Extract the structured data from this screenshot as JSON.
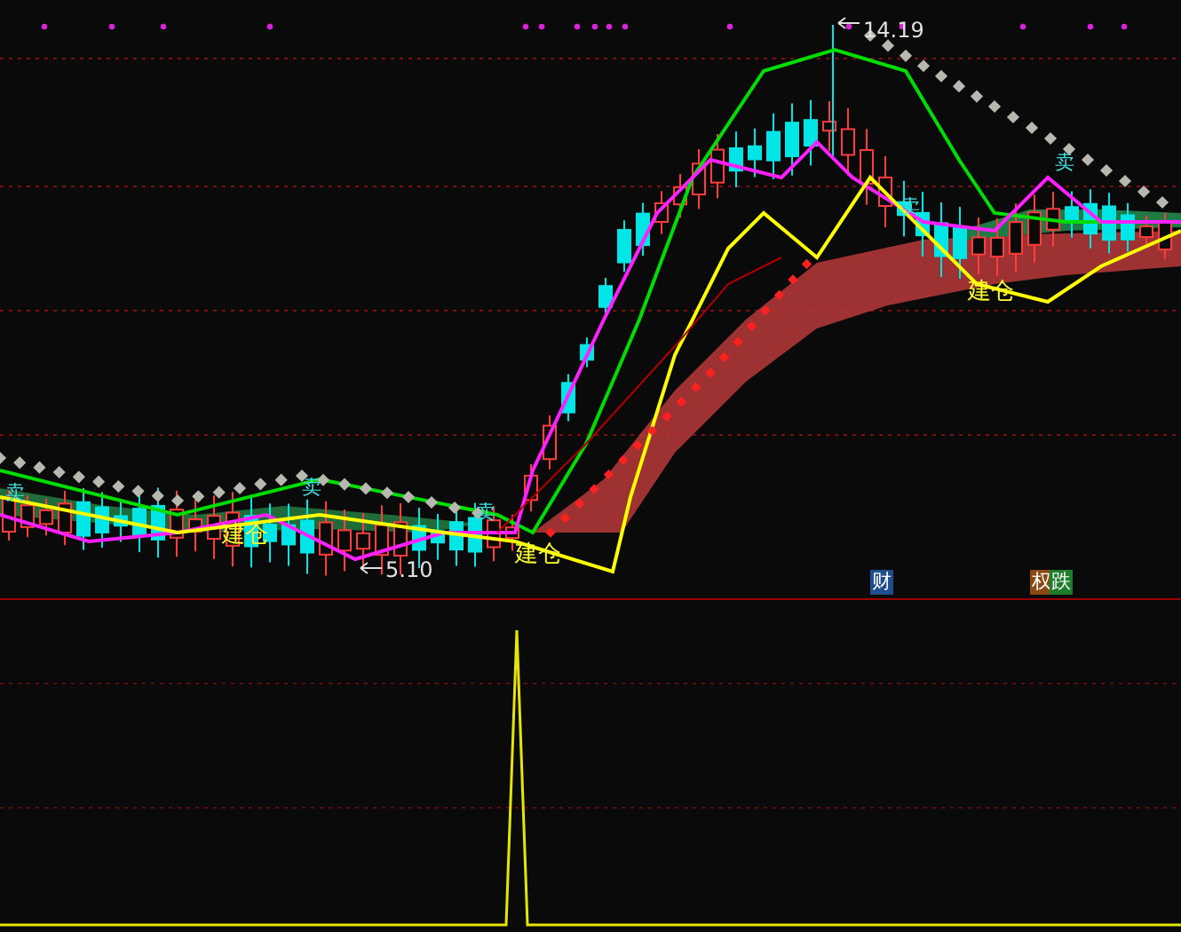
{
  "price_chart": {
    "high_label": "14.19",
    "low_label": "5.10",
    "signals": [
      {
        "kind": "build",
        "text": "建仓"
      },
      {
        "kind": "build",
        "text": "建仓"
      },
      {
        "kind": "build",
        "text": "建仓"
      },
      {
        "kind": "sell",
        "text": "卖"
      },
      {
        "kind": "sell",
        "text": "卖"
      },
      {
        "kind": "sell",
        "text": "卖"
      },
      {
        "kind": "sell",
        "text": "卖"
      },
      {
        "kind": "sell",
        "text": "卖"
      }
    ],
    "event_markers": [
      {
        "text": "财",
        "color": "#1f4e8c"
      },
      {
        "text": "权",
        "color": "#8a4a12"
      },
      {
        "text": "跌",
        "color": "#1e7d2a"
      }
    ]
  }
}
